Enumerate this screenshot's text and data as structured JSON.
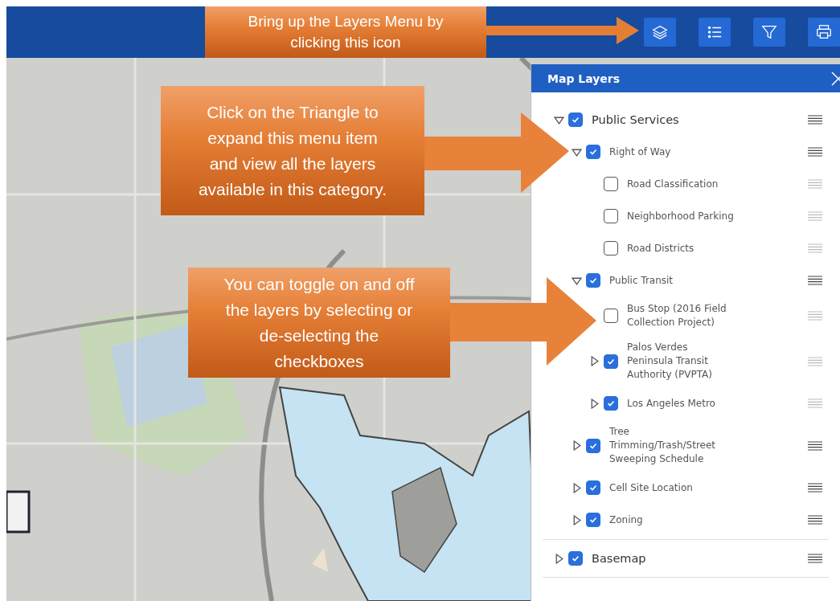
{
  "toolbar": {
    "buttons": [
      {
        "kind": "layers"
      },
      {
        "kind": "legend"
      },
      {
        "kind": "filter"
      },
      {
        "kind": "print"
      }
    ]
  },
  "panel": {
    "title": "Map Layers",
    "layers": [
      {
        "label": "Public Services",
        "kind": "group",
        "checked": true,
        "expanded": true,
        "children": [
          {
            "label": "Right of Way",
            "kind": "group",
            "checked": true,
            "expanded": true,
            "children": [
              {
                "label": "Road Classification",
                "kind": "layer",
                "checked": false
              },
              {
                "label": "Neighborhood Parking",
                "kind": "layer",
                "checked": false
              },
              {
                "label": "Road Districts",
                "kind": "layer",
                "checked": false
              }
            ]
          },
          {
            "label": "Public Transit",
            "kind": "group",
            "checked": true,
            "expanded": true,
            "children": [
              {
                "label": "Bus Stop (2016 Field Collection Project)",
                "kind": "layer",
                "checked": false
              },
              {
                "label": "Palos Verdes Peninsula Transit Authority (PVPTA)",
                "kind": "group",
                "checked": true,
                "expanded": false
              },
              {
                "label": "Los Angeles Metro",
                "kind": "group",
                "checked": true,
                "expanded": false
              }
            ]
          },
          {
            "label": "Tree Trimming/Trash/Street Sweeping Schedule",
            "kind": "group",
            "checked": true,
            "expanded": false
          },
          {
            "label": "Cell Site Location",
            "kind": "group",
            "checked": true,
            "expanded": false
          },
          {
            "label": "Zoning",
            "kind": "group",
            "checked": true,
            "expanded": false
          }
        ]
      },
      {
        "label": "Basemap",
        "kind": "group",
        "checked": true,
        "expanded": false
      }
    ]
  },
  "callouts": [
    {
      "text": "Bring up the Layers Menu by clicking this icon",
      "kind": "top"
    },
    {
      "text": "Click on the Triangle to expand this menu item and view all the layers available in this category.",
      "kind": "expand"
    },
    {
      "text": "You can toggle on and off the layers by selecting or de-selecting the checkboxes",
      "kind": "toggle"
    }
  ]
}
